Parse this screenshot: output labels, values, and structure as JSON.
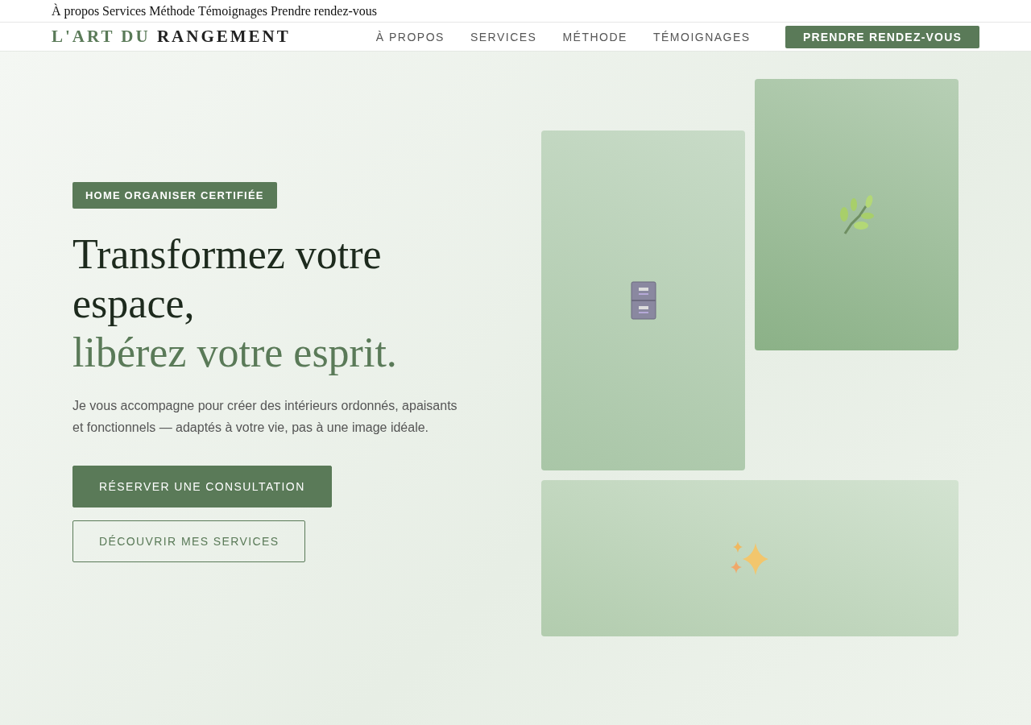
{
  "overlay_nav": {
    "text": "À propos Services Méthode Témoignages Prendre rendez-vous"
  },
  "header": {
    "logo": {
      "accent": "L'ART DU",
      "main": "RANGEMENT"
    },
    "nav": [
      "À PROPOS",
      "SERVICES",
      "MÉTHODE",
      "TÉMOIGNAGES"
    ],
    "cta": "PRENDRE RENDEZ-VOUS"
  },
  "hero": {
    "badge": "HOME ORGANISER CERTIFIÉE",
    "title_lines": [
      "Transformez votre",
      "espace,"
    ],
    "title_accent": "libérez votre esprit.",
    "description": "Je vous accompagne pour créer des intérieurs ordonnés, apaisants et fonctionnels — adaptés à votre vie, pas à une image idéale.",
    "buttons": [
      {
        "label": "RÉSERVER UNE CONSULTATION",
        "kind": "primary"
      },
      {
        "label": "DÉCOUVRIR MES SERVICES",
        "kind": "outline"
      }
    ],
    "cards": [
      {
        "kind": "cabinet"
      },
      {
        "kind": "branch"
      },
      {
        "kind": "sparkles"
      }
    ]
  }
}
